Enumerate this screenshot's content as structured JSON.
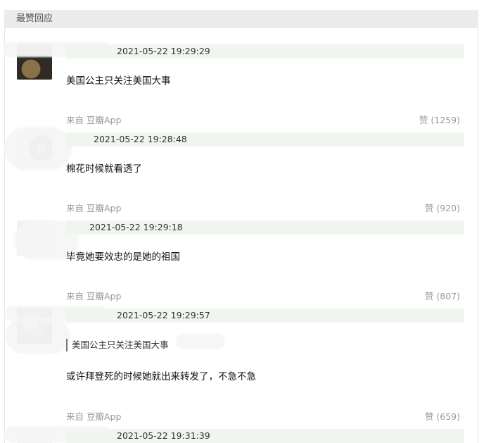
{
  "section": {
    "title": "最赞回应"
  },
  "comments": [
    {
      "time": "2021-05-22 19:29:29",
      "text": "美国公主只关注美国大事",
      "source": "来自 豆瓣App",
      "like_label": "赞",
      "like_count": "(1259)"
    },
    {
      "time": "2021-05-22 19:28:48",
      "text": "棉花时候就看透了",
      "source": "来自 豆瓣App",
      "like_label": "赞",
      "like_count": "(920)"
    },
    {
      "time": "2021-05-22 19:29:18",
      "text": "毕竟她要效忠的是她的祖国",
      "source": "来自 豆瓣App",
      "like_label": "赞",
      "like_count": "(807)"
    },
    {
      "time": "2021-05-22 19:29:57",
      "quote": "美国公主只关注美国大事",
      "text": "或许拜登死的时候她就出来转发了，不急不急",
      "source": "来自 豆瓣App",
      "like_label": "赞",
      "like_count": "(659)"
    },
    {
      "time": "2021-05-22 19:31:39"
    }
  ]
}
